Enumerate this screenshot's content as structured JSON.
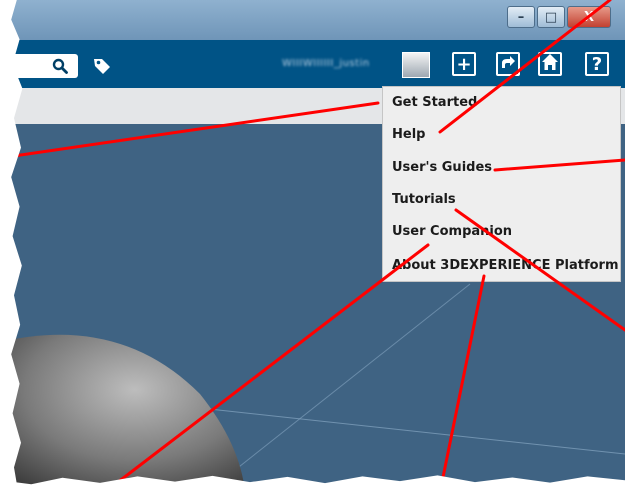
{
  "window": {
    "minimize_glyph": "–",
    "maximize_glyph": "□",
    "close_glyph": "X"
  },
  "toolbar": {
    "user_name": "WIIIWIIIIII_justin",
    "icons": {
      "search": "search-icon",
      "tag": "tag-icon",
      "add": "plus-icon",
      "share": "share-icon",
      "home": "home-icon",
      "help": "help-icon"
    },
    "add_glyph": "+",
    "help_glyph": "?"
  },
  "help_menu": {
    "items": [
      {
        "label": "Get Started"
      },
      {
        "label": "Help"
      },
      {
        "label": "User's Guides"
      },
      {
        "label": "Tutorials"
      },
      {
        "label": "User Companion"
      },
      {
        "label": "About 3DEXPERIENCE Platform"
      }
    ]
  },
  "colors": {
    "toolbar_bg": "#005386",
    "viewport_bg": "#3f6383",
    "menu_bg": "#eeeeee",
    "callout_line": "#ff0000"
  }
}
